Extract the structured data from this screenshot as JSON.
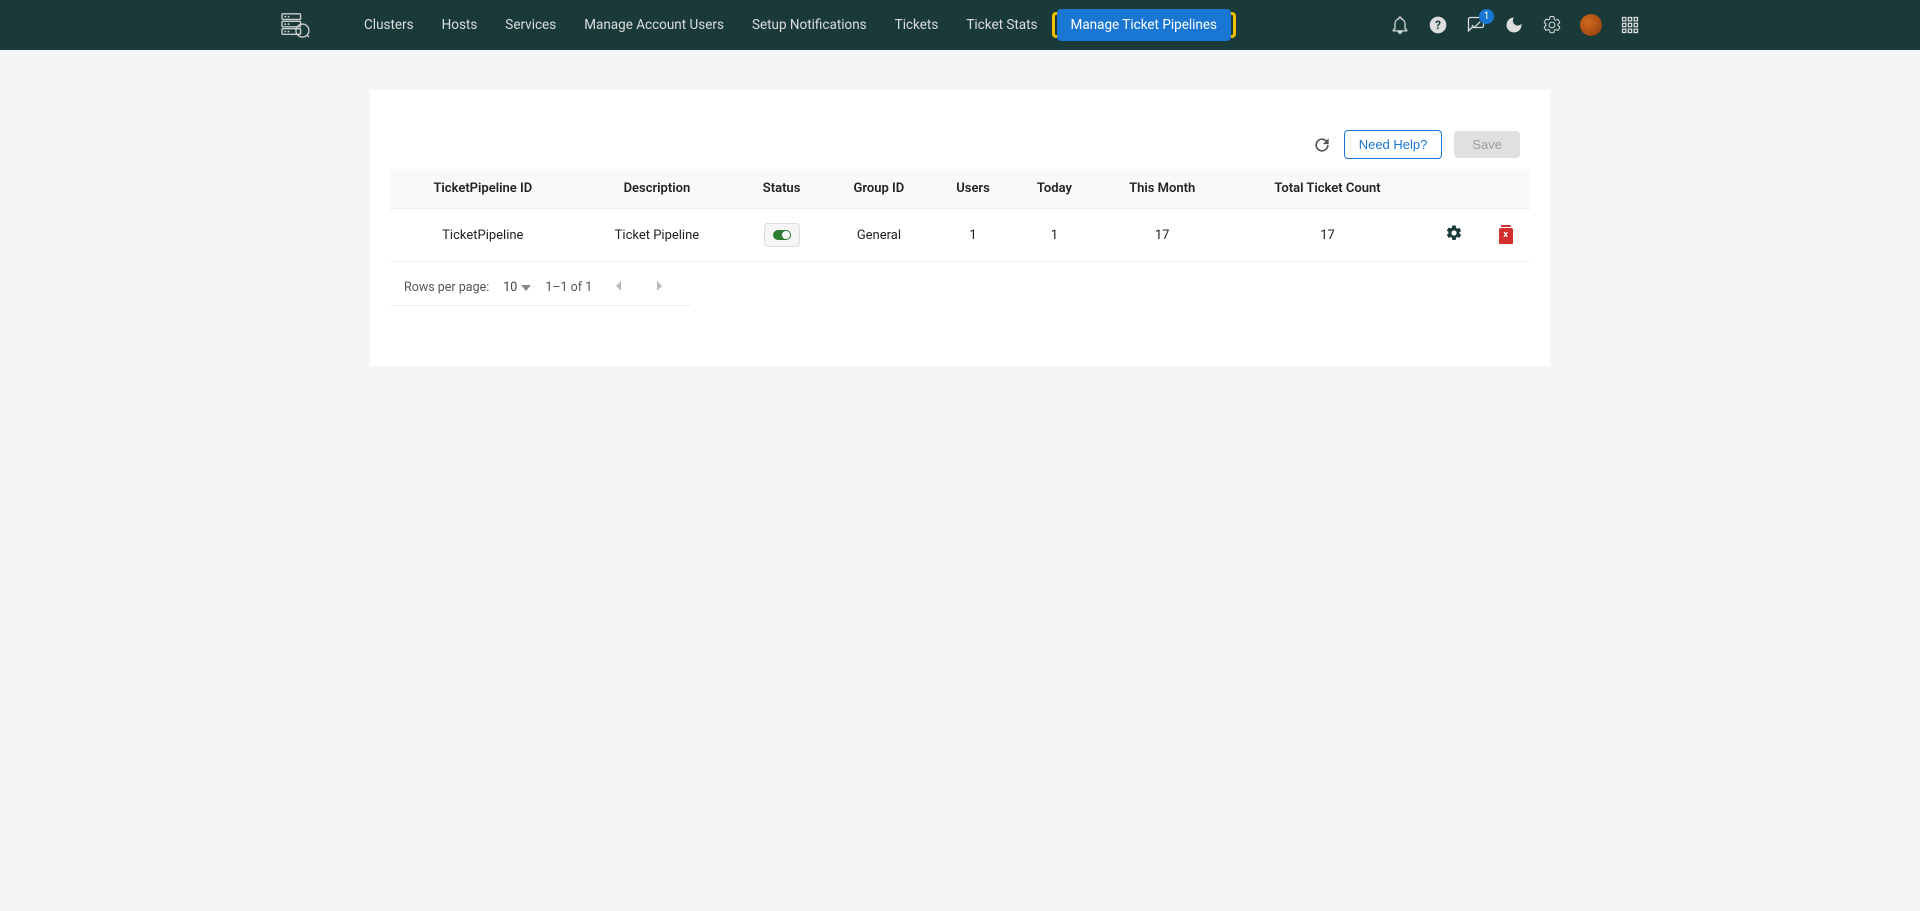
{
  "nav": {
    "items": [
      "Clusters",
      "Hosts",
      "Services",
      "Manage Account Users",
      "Setup Notifications",
      "Tickets",
      "Ticket Stats",
      "Manage Ticket Pipelines"
    ]
  },
  "notifications": {
    "count": "1"
  },
  "toolbar": {
    "help_label": "Need Help?",
    "save_label": "Save"
  },
  "table": {
    "headers": [
      "TicketPipeline ID",
      "Description",
      "Status",
      "Group ID",
      "Users",
      "Today",
      "This Month",
      "Total Ticket Count"
    ],
    "rows": [
      {
        "id": "TicketPipeline",
        "description": "Ticket Pipeline",
        "status": "on",
        "group": "General",
        "users": "1",
        "today": "1",
        "month": "17",
        "total": "17"
      }
    ]
  },
  "pagination": {
    "label": "Rows per page:",
    "per_page": "10",
    "range": "1–1 of 1"
  },
  "delete_glyph": "x"
}
